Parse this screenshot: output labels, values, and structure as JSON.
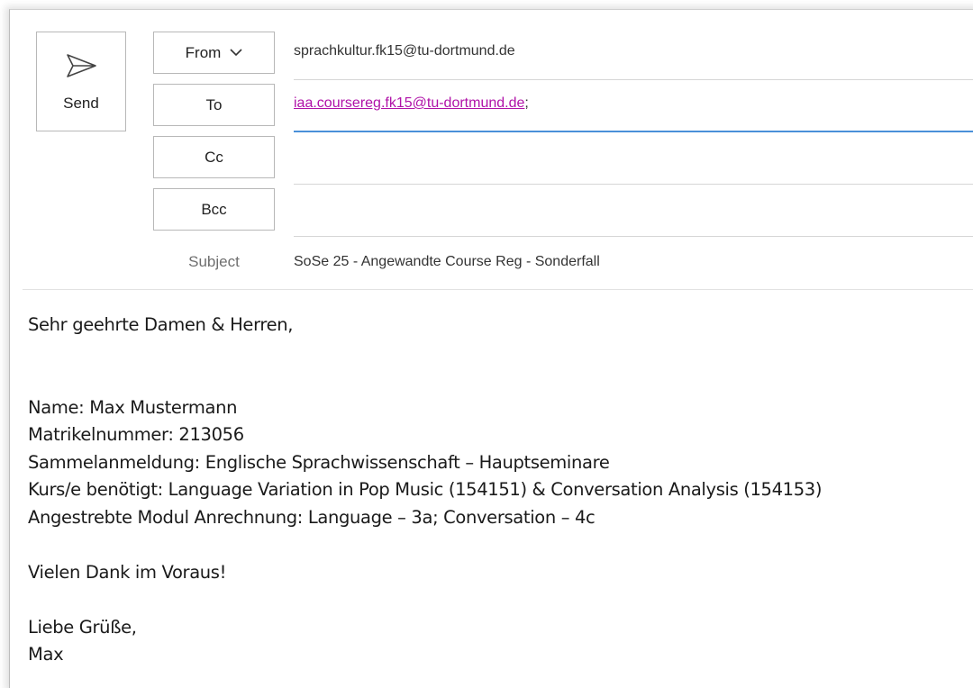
{
  "compose": {
    "send_label": "Send",
    "from_label": "From",
    "to_label": "To",
    "cc_label": "Cc",
    "bcc_label": "Bcc",
    "subject_label": "Subject",
    "from_value": "sprachkultur.fk15@tu-dortmund.de",
    "to_value": "iaa.coursereg.fk15@tu-dortmund.de",
    "to_separator": ";",
    "cc_value": "",
    "bcc_value": "",
    "subject_value": "SoSe 25 - Angewandte Course Reg - Sonderfall"
  },
  "body": {
    "greeting": "Sehr geehrte Damen & Herren,",
    "name_line": "Name: Max Mustermann",
    "matrikel_line": "Matrikelnummer: 213056",
    "sammel_line": "Sammelanmeldung: Englische Sprachwissenschaft – Hauptseminare",
    "kurs_line": "Kurs/e benötigt: Language Variation in Pop Music (154151) & Conversation Analysis (154153)",
    "modul_line": "Angestrebte Modul Anrechnung: Language – 3a; Conversation – 4c",
    "thanks_line": "Vielen Dank im Voraus!",
    "closing_line": "Liebe Grüße,",
    "signature": "Max"
  },
  "icons": {
    "send": "send-icon",
    "from_dropdown": "chevron-down-icon"
  },
  "colors": {
    "link": "#b012a8",
    "active_underline": "#4a90d9"
  }
}
